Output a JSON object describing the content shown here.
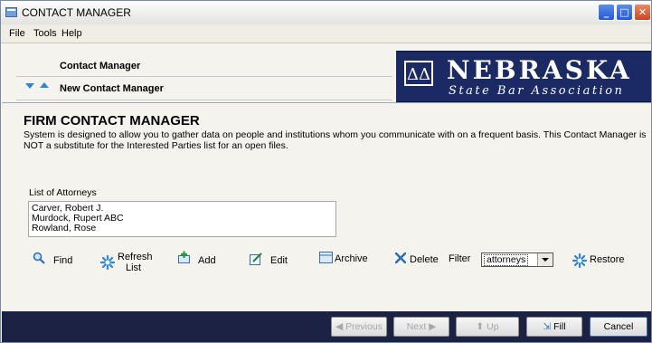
{
  "window": {
    "title": "CONTACT MANAGER",
    "controls": {
      "minimize": "_",
      "maximize": "□",
      "close": "✕"
    }
  },
  "menu": {
    "file": "File",
    "tools": "Tools",
    "help": "Help"
  },
  "navigation": {
    "items": [
      "Contact Manager",
      "New Contact Manager"
    ],
    "icons": [
      "arrow-down-icon",
      "arrow-up-icon"
    ]
  },
  "logo": {
    "title": "NEBRASKA",
    "subtitle": "State Bar Association",
    "symbol": "ΔΔ"
  },
  "page": {
    "title": "FIRM CONTACT MANAGER",
    "description": "System is designed to allow you to gather data on people and institutions whom you communicate with on a frequent basis.  This Contact Manager is NOT a substitute for the Interested Parties list for an open files."
  },
  "list": {
    "label": "List of Attorneys",
    "items": [
      "Carver, Robert J.",
      "Murdock, Rupert ABC",
      "Rowland, Rose"
    ]
  },
  "toolbar": {
    "find": "Find",
    "refresh_line1": "Refresh",
    "refresh_line2": "List",
    "add": "Add",
    "edit": "Edit",
    "archive": "Archive",
    "delete": "Delete",
    "filter_label": "Filter",
    "filter_value": "attorneys",
    "restore": "Restore"
  },
  "footer": {
    "previous": "Previous",
    "next": "Next",
    "up": "Up",
    "fill": "Fill",
    "cancel": "Cancel"
  },
  "colors": {
    "bottom_bar": "#1b2243",
    "logo_bg": "#1b2a63",
    "accent": "#2f86d6"
  }
}
